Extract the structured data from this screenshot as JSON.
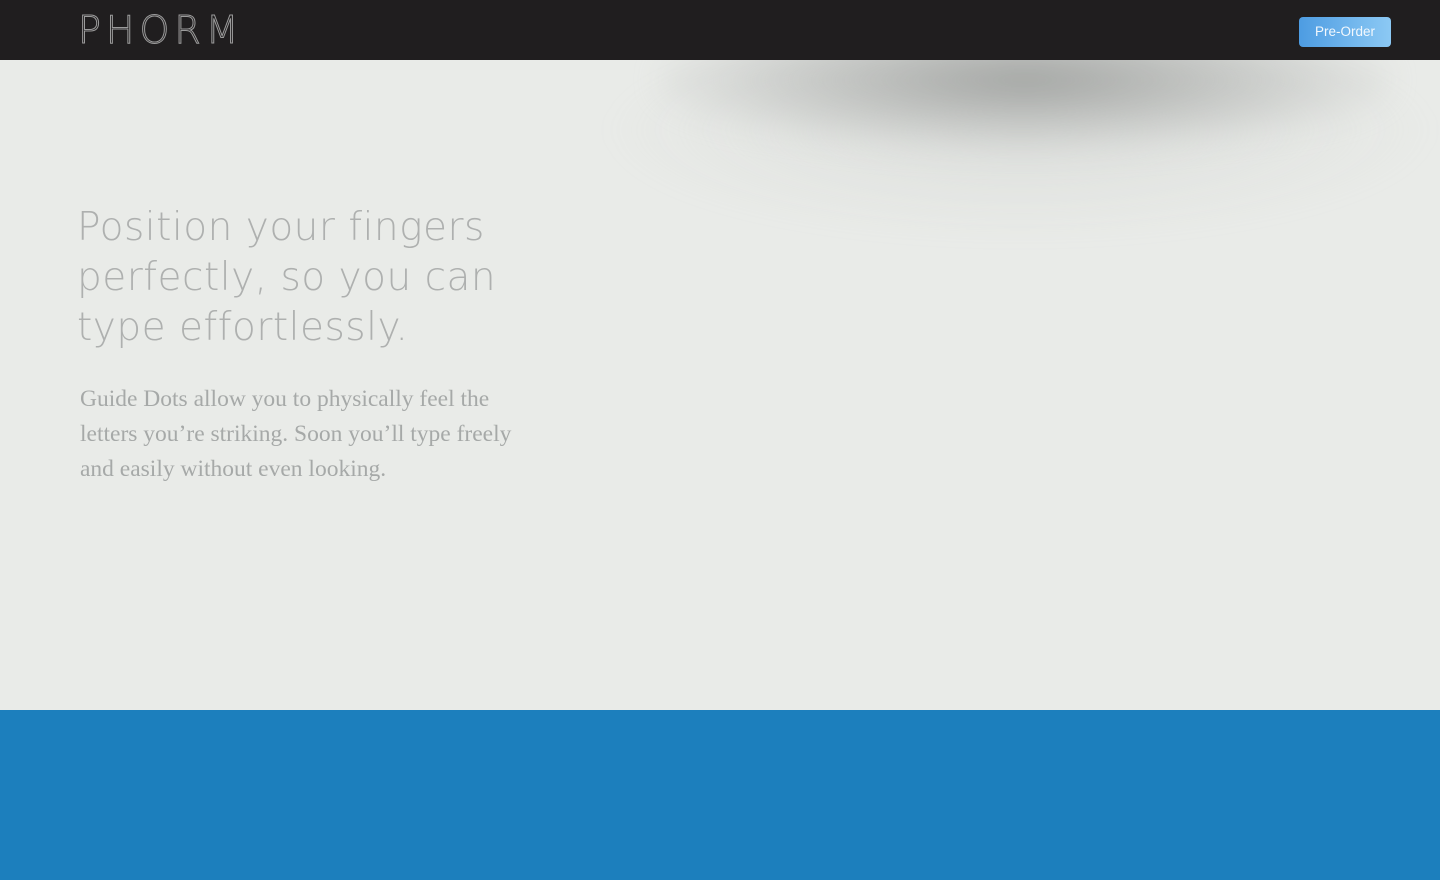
{
  "header": {
    "logo_text": "PHORM",
    "preorder_label": "Pre-Order"
  },
  "hero": {
    "headline": "Position your fingers perfectly, so you can type effortlessly.",
    "body": "Guide Dots allow you to physically feel the letters you’re striking. Soon you’ll type freely and easily without even looking."
  },
  "colors": {
    "topbar": "#201e1f",
    "hero_background": "#e9ebe8",
    "accent_blue": "#1c7fbd",
    "button_gradient_start": "#4d9ce2",
    "button_gradient_end": "#8cc9f4"
  }
}
